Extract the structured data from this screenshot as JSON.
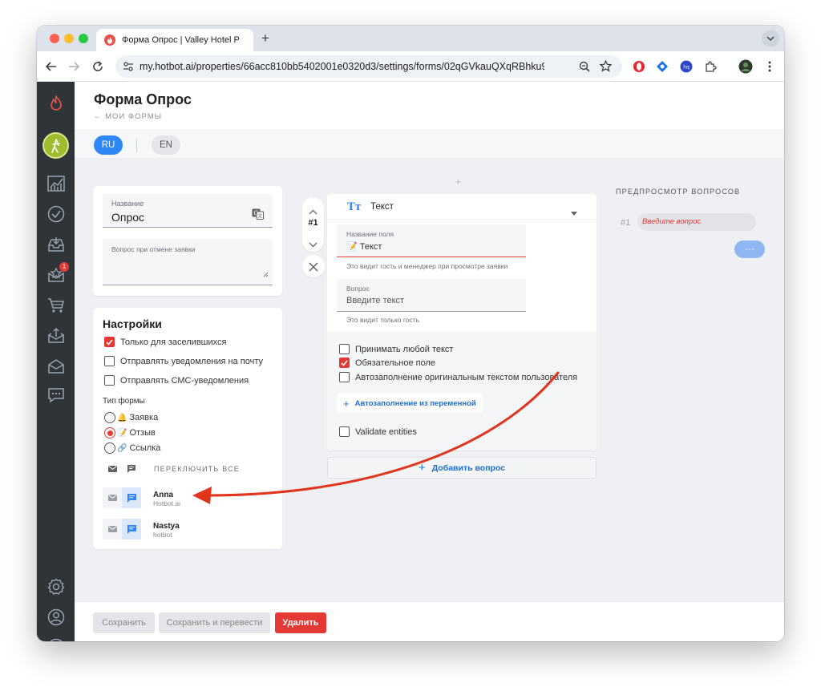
{
  "browser": {
    "tab_title": "Форма Опрос | Valley Hotel P",
    "url": "my.hotbot.ai/properties/66acc810bb5402001e0320d3/settings/forms/02qGVkauQXqRBhku9IuTp...",
    "icons": [
      "back-icon",
      "forward-icon",
      "reload-icon",
      "site-settings-icon",
      "zoom-icon",
      "star-icon",
      "extensions-icon",
      "more-icon"
    ]
  },
  "header": {
    "title": "Форма Опрос",
    "breadcrumb": "← МОИ ФОРМЫ"
  },
  "languages": {
    "ru": "RU",
    "en": "EN",
    "active": "RU"
  },
  "sidebar": {
    "badge_count": "1"
  },
  "form": {
    "name_label": "Название",
    "name_value": "Опрос",
    "cancel_question_label": "Вопрос при отмене заявки"
  },
  "settings": {
    "title": "Настройки",
    "only_checked_in": "Только для заселившихся",
    "email_notifications": "Отправлять уведомления на почту",
    "sms_notifications": "Отправлять СМС-уведомления",
    "form_type_label": "Тип формы",
    "types": [
      {
        "emoji": "🔔",
        "label": "Заявка",
        "selected": false
      },
      {
        "emoji": "📝",
        "label": "Отзыв",
        "selected": true
      },
      {
        "emoji": "🔗",
        "label": "Ссылка",
        "selected": false
      }
    ],
    "toggle_all": "ПЕРЕКЛЮЧИТЬ ВСЕ",
    "users": [
      {
        "name": "Anna",
        "org": "Hotbot.ai"
      },
      {
        "name": "Nastya",
        "org": "hotbot"
      }
    ]
  },
  "question": {
    "number": "#1",
    "type_label": "Текст",
    "field_name_label": "Название поля",
    "field_name_value": "📝 Текст",
    "field_name_helper": "Это видит гость и менеджер при просмотре заявки",
    "question_label": "Вопрос",
    "question_placeholder": "Введите текст",
    "question_helper": "Это видит только гость",
    "accept_any_text": "Принимать любой текст",
    "required_field": "Обязательное поле",
    "autofill_original": "Автозаполнение оригинальным текстом пользователя",
    "autofill_variable": "Автозаполнение из переменной",
    "validate_entities": "Validate entities",
    "add_question": "Добавить вопрос",
    "plus": "+"
  },
  "preview": {
    "title": "ПРЕДПРОСМОТР ВОПРОСОВ",
    "number": "#1",
    "placeholder": "Введите вопрос",
    "more": "···"
  },
  "footer": {
    "save": "Сохранить",
    "save_translate": "Сохранить и перевести",
    "delete": "Удалить"
  },
  "colors": {
    "accent_blue": "#2f86f6",
    "danger_red": "#e53935",
    "sidebar": "#2f3439",
    "arrow": "#e0341c"
  }
}
